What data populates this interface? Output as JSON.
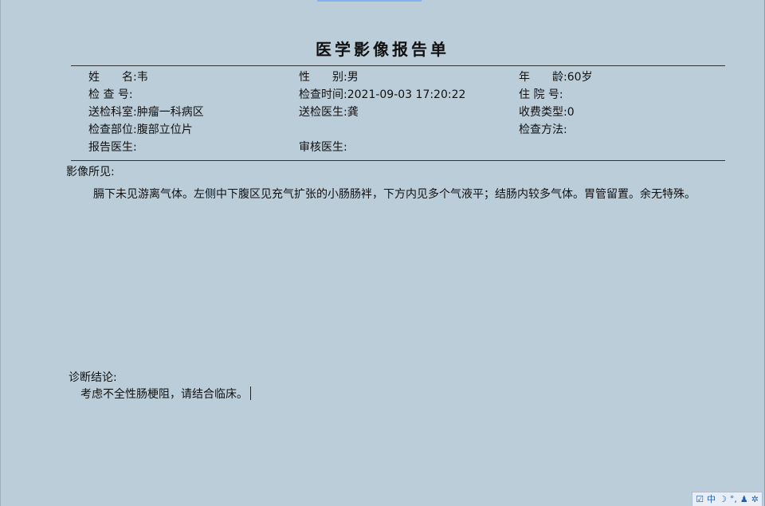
{
  "report": {
    "title": "医学影像报告单"
  },
  "header": {
    "name_label": "姓　　名:",
    "name_value": "韦",
    "sex_label": "性　　别:",
    "sex_value": "男",
    "age_label": "年　　龄:",
    "age_value": "60岁",
    "exam_no_label": "检 查 号:",
    "exam_no_value": "",
    "exam_time_label": "检查时间:",
    "exam_time_value": "2021-09-03 17:20:22",
    "inpatient_no_label": "住 院 号:",
    "inpatient_no_value": "",
    "dept_label": "送检科室:",
    "dept_value": "肿瘤一科病区",
    "ref_doctor_label": "送检医生:",
    "ref_doctor_value": "龚",
    "fee_type_label": "收费类型:",
    "fee_type_value": "0",
    "body_part_label": "检查部位:",
    "body_part_value": "腹部立位片",
    "method_label": "检查方法:",
    "method_value": "",
    "report_doctor_label": "报告医生:",
    "report_doctor_value": "",
    "review_doctor_label": "审核医生:",
    "review_doctor_value": ""
  },
  "findings": {
    "label": "影像所见:",
    "text": "膈下未见游离气体。左侧中下腹区见充气扩张的小肠肠袢，下方内见多个气液平；结肠内较多气体。胃管留置。余无特殊。"
  },
  "conclusion": {
    "label": "诊断结论:",
    "text": "考虑不全性肠梗阻，请结合临床。"
  },
  "tray": {
    "icons": [
      "checkbox-icon",
      "ime-icon",
      "moon-icon",
      "punctuation-icon",
      "user-icon",
      "gear-icon"
    ],
    "ime_label": "中"
  }
}
